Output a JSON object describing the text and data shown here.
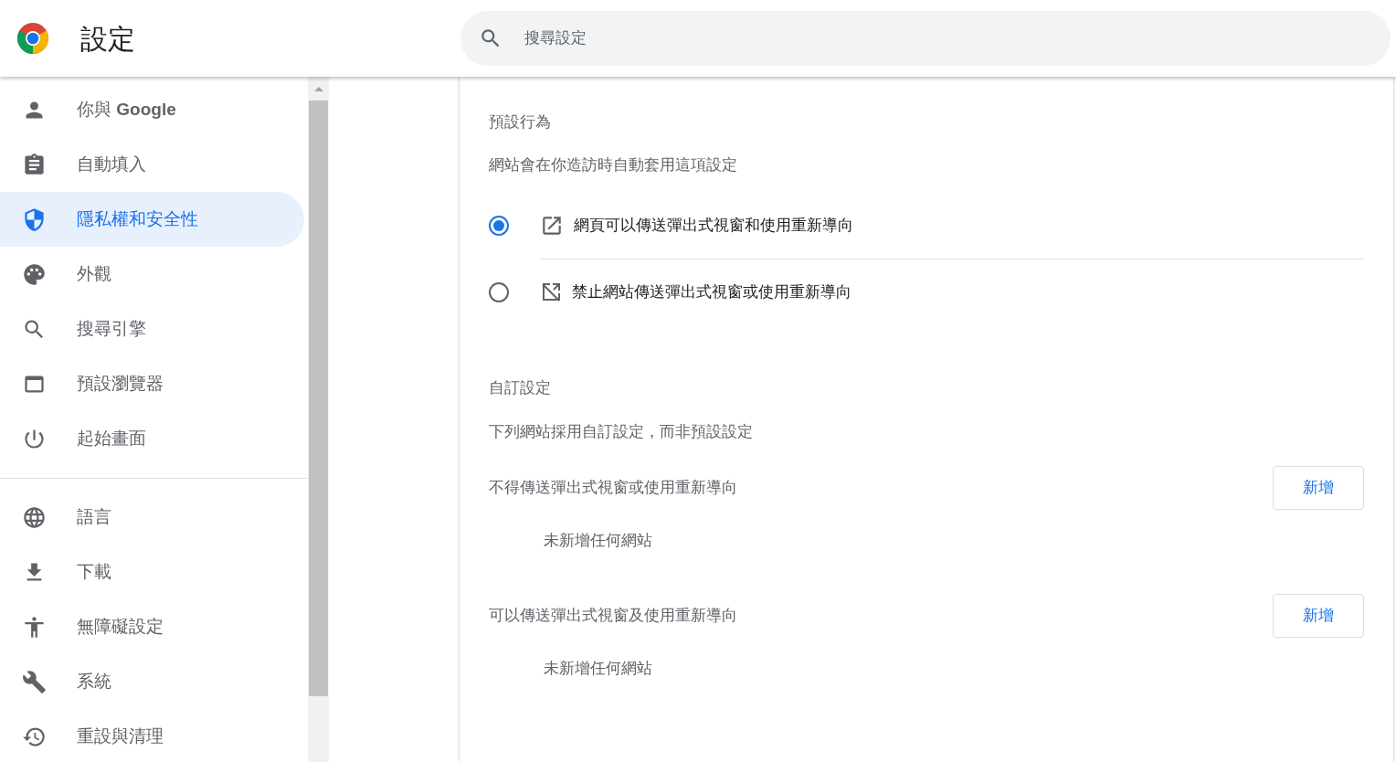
{
  "header": {
    "title": "設定",
    "search": {
      "placeholder": "搜尋設定"
    }
  },
  "sidebar": {
    "groups": [
      {
        "items": [
          {
            "label": "你與 **Google**",
            "selected": false
          },
          {
            "label": "自動填入",
            "selected": false
          },
          {
            "label": "隱私權和安全性",
            "selected": true
          },
          {
            "label": "外觀",
            "selected": false
          },
          {
            "label": "搜尋引擎",
            "selected": false
          },
          {
            "label": "預設瀏覽器",
            "selected": false
          },
          {
            "label": "起始畫面",
            "selected": false
          }
        ]
      },
      {
        "items": [
          {
            "label": "語言",
            "selected": false
          },
          {
            "label": "下載",
            "selected": false
          },
          {
            "label": "無障礙設定",
            "selected": false
          },
          {
            "label": "系統",
            "selected": false
          },
          {
            "label": "重設與清理",
            "selected": false
          }
        ]
      }
    ]
  },
  "default_behavior": {
    "heading": "預設行為",
    "description": "網站會在你造訪時自動套用這項設定",
    "options": [
      {
        "label": "網頁可以傳送彈出式視窗和使用重新導向",
        "kind": "allow",
        "selected": true
      },
      {
        "label": "禁止網站傳送彈出式視窗或使用重新導向",
        "kind": "block",
        "selected": false
      }
    ]
  },
  "custom": {
    "heading": "自訂設定",
    "description": "下列網站採用自訂設定，而非預設設定",
    "lists": [
      {
        "title": "不得傳送彈出式視窗或使用重新導向",
        "button": "新增",
        "empty": "未新增任何網站"
      },
      {
        "title": "可以傳送彈出式視窗及使用重新導向",
        "button": "新增",
        "empty": "未新增任何網站"
      }
    ]
  }
}
